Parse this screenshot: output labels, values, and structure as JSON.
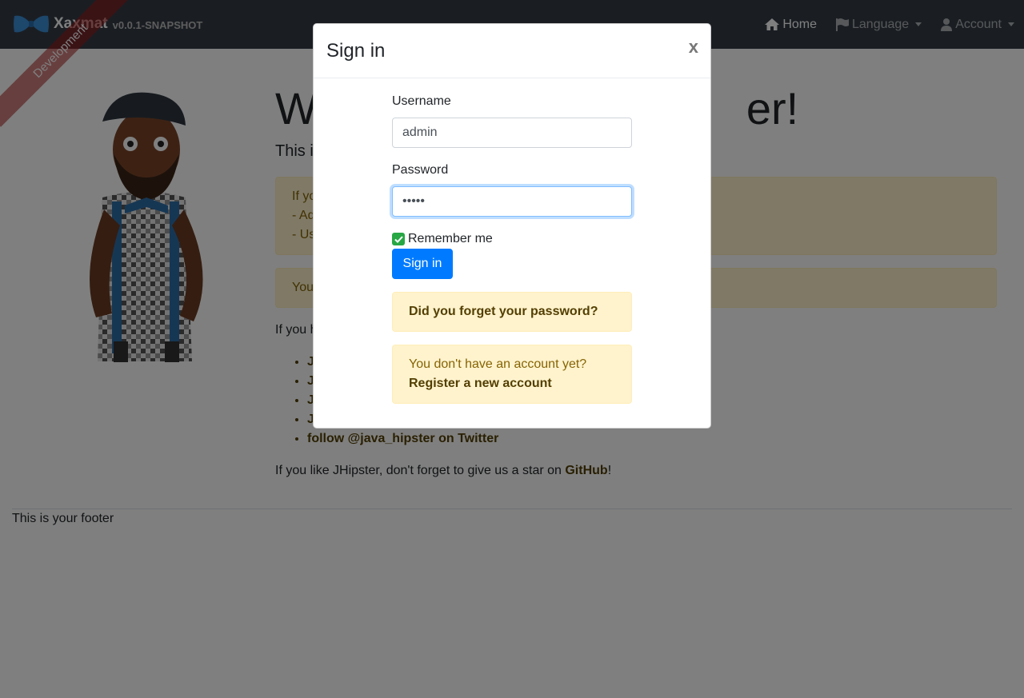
{
  "navbar": {
    "brand_name": "Xaxmat",
    "version": "v0.0.1-SNAPSHOT",
    "items": [
      {
        "label": "Home",
        "icon": "home-icon"
      },
      {
        "label": "Language",
        "icon": "flag-icon"
      },
      {
        "label": "Account",
        "icon": "user-icon"
      }
    ]
  },
  "ribbon": "Development",
  "main": {
    "headline_start": "W",
    "headline_end": "er!",
    "lead_start": "This i",
    "alert1_lines": [
      "If yo",
      "- Ad",
      "- Us"
    ],
    "alert2_start": "You",
    "para1_start": "If you h",
    "links": [
      "J",
      "J",
      "J",
      "J",
      "follow @java_hipster on Twitter"
    ],
    "star_text_before": "If you like JHipster, don't forget to give us a star on ",
    "star_link": "GitHub",
    "star_text_after": "!"
  },
  "footer": "This is your footer",
  "modal": {
    "title": "Sign in",
    "close": "x",
    "username_label": "Username",
    "username_value": "admin",
    "password_label": "Password",
    "password_value": "•••••",
    "remember_label": "Remember me",
    "remember_checked": true,
    "signin_button": "Sign in",
    "forgot_password": "Did you forget your password?",
    "no_account": "You don't have an account yet?",
    "register": "Register a new account"
  },
  "colors": {
    "navbar": "#353d47",
    "primary": "#007bff",
    "warning_bg": "#fff3cd",
    "success": "#28a745"
  }
}
